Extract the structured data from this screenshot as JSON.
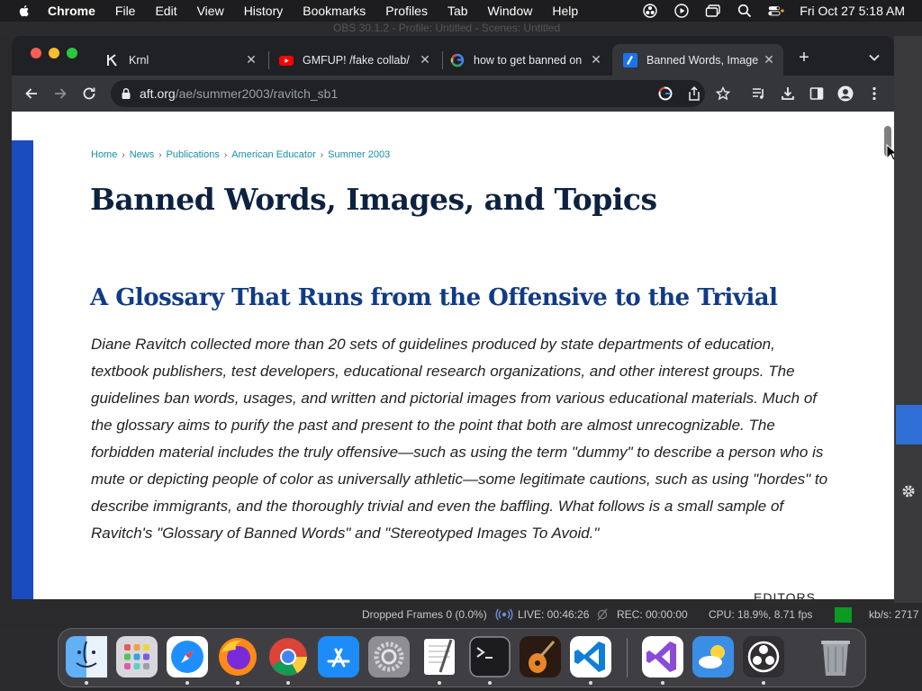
{
  "menubar": {
    "app": "Chrome",
    "items": [
      "File",
      "Edit",
      "View",
      "History",
      "Bookmarks",
      "Profiles",
      "Tab",
      "Window",
      "Help"
    ],
    "clock": "Fri Oct 27  5:18 AM"
  },
  "backdrop": {
    "obs_title": "OBS 30.1.2 - Profile: Untitled - Scenes: Untitled"
  },
  "tabs": [
    {
      "title": "Krnl"
    },
    {
      "title": "GMFUP! /fake collab/"
    },
    {
      "title": "how to get banned on"
    },
    {
      "title": "Banned Words, Image"
    }
  ],
  "toolbar": {
    "url_host": "aft.org",
    "url_path": "/ae/summer2003/ravitch_sb1"
  },
  "page": {
    "breadcrumb": [
      "Home",
      "News",
      "Publications",
      "American Educator",
      "Summer 2003"
    ],
    "title": "Banned Words, Images, and Topics",
    "subtitle": "A Glossary That Runs from the Offensive to the Trivial",
    "intro": "Diane Ravitch collected more than 20 sets of guidelines produced by state departments of education, textbook publishers, test developers, educational research organizations, and other interest groups. The guidelines ban words, usages, and written and pictorial images from various educational materials. Much of the glossary aims to purify the past and present to the point that both are almost unrecognizable. The forbidden material includes the truly offensive—such as using the term \"dummy\" to describe a person who is mute or depicting people of color as universally athletic—some legitimate cautions, such as using \"hordes\" to describe immigrants, and the thoroughly trivial and even the baffling. What follows is a small sample of Ravitch's \"Glossary of Banned Words\" and \"Stereotyped Images To Avoid.\"",
    "editors_label": "EDITORS"
  },
  "status": {
    "dropped": "Dropped Frames 0 (0.0%)",
    "live": "LIVE: 00:46:26",
    "rec": "REC: 00:00:00",
    "cpu": "CPU: 18.9%, 8.71 fps",
    "kbs": "kb/s: 2717"
  },
  "dock": {
    "apps": [
      "finder-icon",
      "launchpad-icon",
      "safari-icon",
      "firefox-icon",
      "chrome-icon",
      "app-store-icon",
      "system-settings-icon",
      "textedit-icon",
      "terminal-icon",
      "garageband-icon",
      "vscode-icon",
      "visual-studio-icon",
      "weather-icon",
      "obs-icon",
      "trash-icon"
    ]
  },
  "colors": {
    "title": "#0d2240",
    "subtitle": "#113b85",
    "link": "#1a8fa9",
    "accent_bar": "#1a4bbf"
  }
}
